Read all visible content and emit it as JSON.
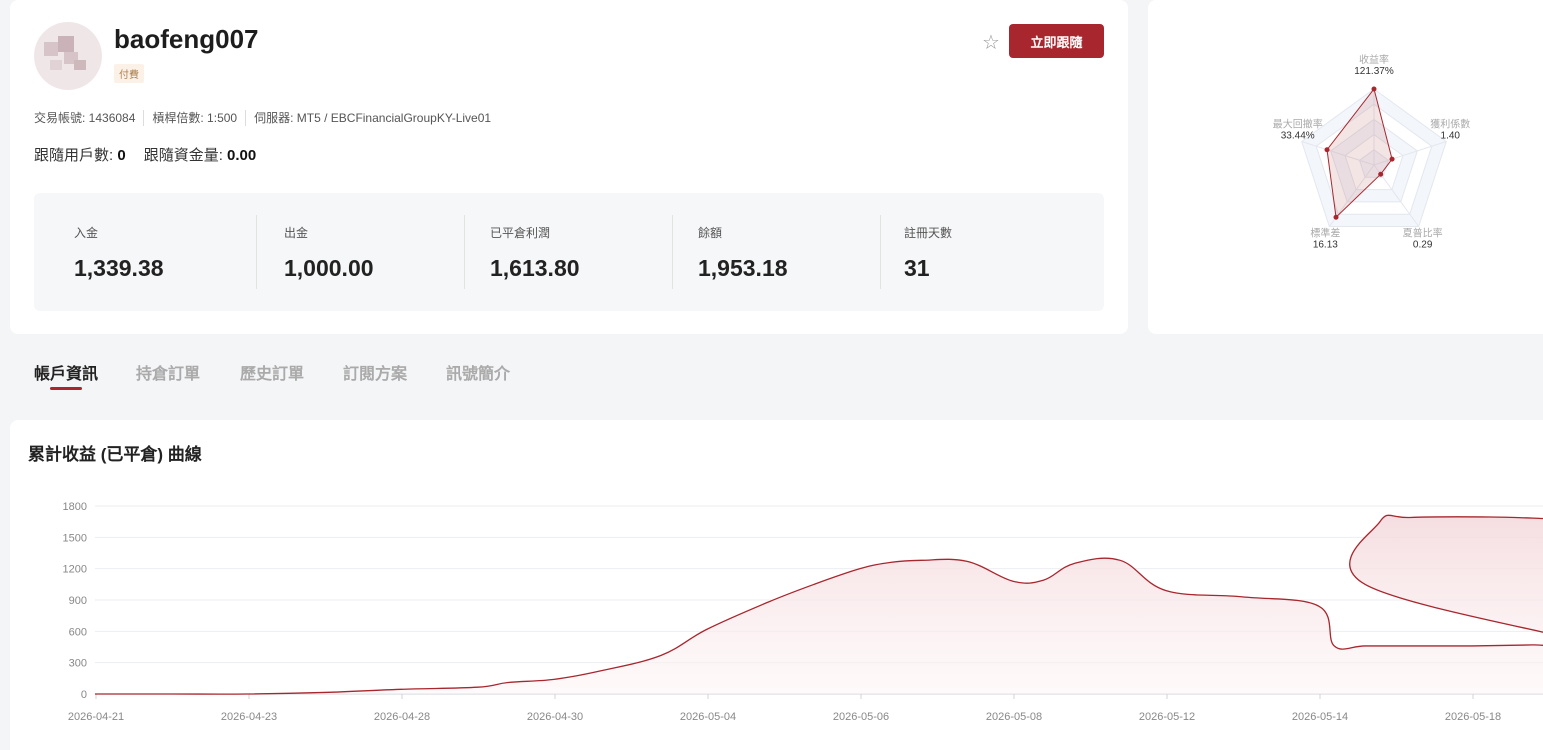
{
  "profile": {
    "username": "baofeng007",
    "badge": "付費",
    "follow_button": "立即跟隨",
    "star_icon": "☆",
    "meta": [
      "交易帳號: 1436084",
      "槓桿倍數: 1:500",
      "伺服器: MT5 / EBCFinancialGroupKY-Live01"
    ],
    "followers_label": "跟隨用戶數:",
    "followers_value": "0",
    "follow_funds_label": "跟隨資金量:",
    "follow_funds_value": "0.00"
  },
  "stats": [
    {
      "label": "入金",
      "value": "1,339.38"
    },
    {
      "label": "出金",
      "value": "1,000.00"
    },
    {
      "label": "已平倉利潤",
      "value": "1,613.80"
    },
    {
      "label": "餘額",
      "value": "1,953.18"
    },
    {
      "label": "註冊天數",
      "value": "31"
    }
  ],
  "radar": {
    "axes": [
      {
        "label": "收益率",
        "value_text": "121.37%",
        "ratio": 1.0
      },
      {
        "label": "獲利係數",
        "value_text": "1.40",
        "ratio": 0.25
      },
      {
        "label": "夏普比率",
        "value_text": "0.29",
        "ratio": 0.15
      },
      {
        "label": "標準差",
        "value_text": "16.13",
        "ratio": 0.85
      },
      {
        "label": "最大回撤率",
        "value_text": "33.44%",
        "ratio": 0.65
      }
    ],
    "accent_color": "#a8262d"
  },
  "tabs": [
    {
      "label": "帳戶資訊",
      "active": true
    },
    {
      "label": "持倉訂單",
      "active": false
    },
    {
      "label": "歷史訂單",
      "active": false
    },
    {
      "label": "訂閱方案",
      "active": false
    },
    {
      "label": "訊號簡介",
      "active": false
    }
  ],
  "chart_data": {
    "type": "area",
    "title": "累計收益 (已平倉) 曲線",
    "ylim": [
      0,
      1800
    ],
    "yticks": [
      0,
      300,
      600,
      900,
      1200,
      1500,
      1800
    ],
    "x_labels": [
      "2026-04-21",
      "2026-04-23",
      "2026-04-28",
      "2026-04-30",
      "2026-05-04",
      "2026-05-06",
      "2026-05-08",
      "2026-05-12",
      "2026-05-14",
      "2026-05-18"
    ],
    "x": [
      0,
      0.5,
      1,
      1.5,
      2,
      2.5,
      2.7,
      3,
      3.3,
      3.7,
      4,
      4.4,
      4.7,
      5,
      5.2,
      5.4,
      5.7,
      6,
      6.2,
      6.4,
      6.7,
      7,
      7.5,
      8,
      8.1,
      8.3,
      8.6,
      9,
      9.4,
      9.8
    ],
    "values": [
      0,
      0,
      0,
      15,
      45,
      65,
      110,
      140,
      220,
      370,
      620,
      880,
      1050,
      1200,
      1260,
      1280,
      1270,
      1080,
      1090,
      1250,
      1280,
      990,
      930,
      840,
      460,
      460,
      460,
      460,
      470,
      470
    ],
    "grid": true,
    "line_color": "#a8262d"
  }
}
